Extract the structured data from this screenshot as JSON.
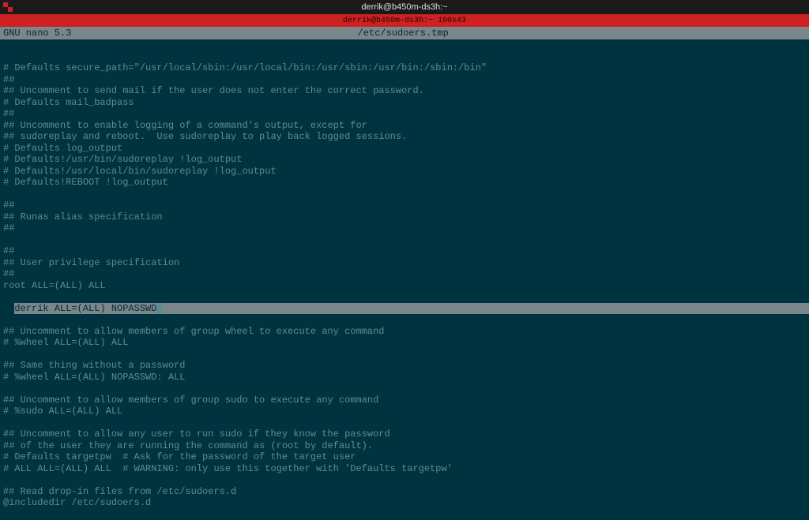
{
  "window": {
    "title": "derrik@b450m-ds3h:~"
  },
  "tab": {
    "label": "derrik@b450m-ds3h:~ 190x43"
  },
  "nano": {
    "app_name": "  GNU nano 5.3",
    "filename": "/etc/sudoers.tmp"
  },
  "lines": [
    "# Defaults secure_path=\"/usr/local/sbin:/usr/local/bin:/usr/sbin:/usr/bin:/sbin:/bin\"",
    "##",
    "## Uncomment to send mail if the user does not enter the correct password.",
    "# Defaults mail_badpass",
    "##",
    "## Uncomment to enable logging of a command's output, except for",
    "## sudoreplay and reboot.  Use sudoreplay to play back logged sessions.",
    "# Defaults log_output",
    "# Defaults!/usr/bin/sudoreplay !log_output",
    "# Defaults!/usr/local/bin/sudoreplay !log_output",
    "# Defaults!REBOOT !log_output",
    "",
    "##",
    "## Runas alias specification",
    "##",
    "",
    "##",
    "## User privilege specification",
    "##",
    "root ALL=(ALL) ALL"
  ],
  "highlighted_line": "derrik ALL=(ALL) NOPASSWD",
  "lines_after": [
    "## Uncomment to allow members of group wheel to execute any command",
    "# %wheel ALL=(ALL) ALL",
    "",
    "## Same thing without a password",
    "# %wheel ALL=(ALL) NOPASSWD: ALL",
    "",
    "## Uncomment to allow members of group sudo to execute any command",
    "# %sudo ALL=(ALL) ALL",
    "",
    "## Uncomment to allow any user to run sudo if they know the password",
    "## of the user they are running the command as (root by default).",
    "# Defaults targetpw  # Ask for the password of the target user",
    "# ALL ALL=(ALL) ALL  # WARNING: only use this together with 'Defaults targetpw'",
    "",
    "## Read drop-in files from /etc/sudoers.d",
    "@includedir /etc/sudoers.d"
  ]
}
